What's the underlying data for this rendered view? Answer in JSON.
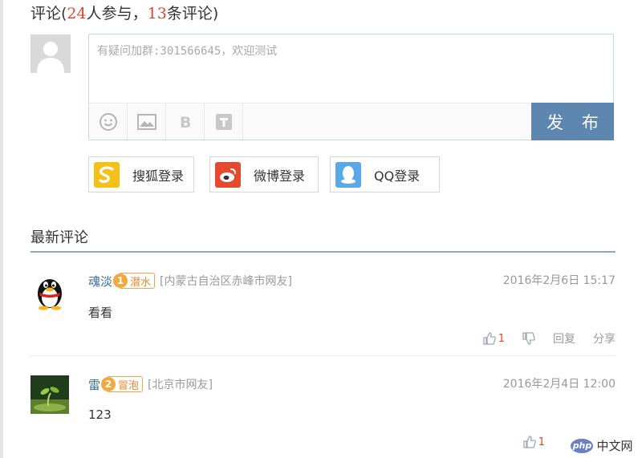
{
  "header": {
    "prefix": "评论(",
    "participants": "24",
    "participants_suffix": "人参与，",
    "comments": "13",
    "comments_suffix": "条评论)"
  },
  "editor": {
    "placeholder": "有疑问加群:301566645，欢迎测试",
    "tools": [
      "emoji-icon",
      "image-icon",
      "bold-icon",
      "text-format-icon"
    ],
    "publish_label": "发 布"
  },
  "logins": [
    {
      "label": "搜狐登录",
      "icon": "sohu-icon",
      "color": "#f5c119"
    },
    {
      "label": "微博登录",
      "icon": "weibo-icon",
      "color": "#e64a2e"
    },
    {
      "label": "QQ登录",
      "icon": "qq-icon",
      "color": "#5aa8e8"
    }
  ],
  "latest": {
    "title": "最新评论",
    "comments": [
      {
        "name": "魂淡",
        "level": "1",
        "badge": "潜水",
        "location": "[内蒙古自治区赤峰市网友]",
        "time": "2016年2月6日 15:17",
        "text": "看看",
        "likes": "1",
        "reply": "回复",
        "share": "分享"
      },
      {
        "name": "雷",
        "level": "2",
        "badge": "冒泡",
        "location": "[北京市网友]",
        "time": "2016年2月4日 12:00",
        "text": "123",
        "likes": "1",
        "reply": "回复"
      }
    ]
  },
  "watermark": {
    "logo": "php",
    "text": "中文网"
  },
  "colors": {
    "accent": "#5d87b1",
    "highlight": "#e0472b",
    "badge": "#f3a93e"
  }
}
